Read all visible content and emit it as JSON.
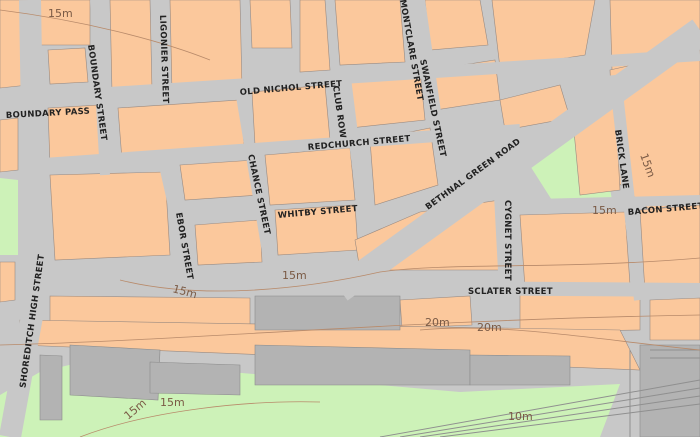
{
  "colors": {
    "road": "#c8c8c8",
    "building": "#fbc89c",
    "building_outline": "#9a8a80",
    "park": "#cdf2b8",
    "rail_building": "#b3b3b3",
    "contour": "#b88a6a",
    "rail": "#8f8f8f"
  },
  "streets": {
    "boundary_pass": "BOUNDARY PASS",
    "boundary_street": "BOUNDARY STREET",
    "ligonier_street": "LIGONIER STREET",
    "old_nichol_street": "OLD NICHOL STREET",
    "club_row": "CLUB ROW",
    "montclare_street": "MONTCLARE STREET",
    "swanfield_street": "SWANFIELD STREET",
    "redchurch_street": "REDCHURCH STREET",
    "bethnal_green_road": "BETHNAL GREEN ROAD",
    "brick_lane": "BRICK LANE",
    "chance_street": "CHANCE STREET",
    "whitby_street": "WHITBY STREET",
    "ebor_street": "EBOR STREET",
    "bacon_street": "BACON STREET",
    "cygnet_street": "CYGNET STREET",
    "sclater_street": "SCLATER STREET",
    "shoreditch_high_street": "SHOREDITCH HIGH STREET"
  },
  "contours": {
    "c15_a": "15m",
    "c15_b": "15m",
    "c15_c": "15m",
    "c15_d": "15m",
    "c15_e": "15m",
    "c15_f": "15m",
    "c15_g": "15m",
    "c20_a": "20m",
    "c20_b": "20m",
    "c10": "10m"
  }
}
